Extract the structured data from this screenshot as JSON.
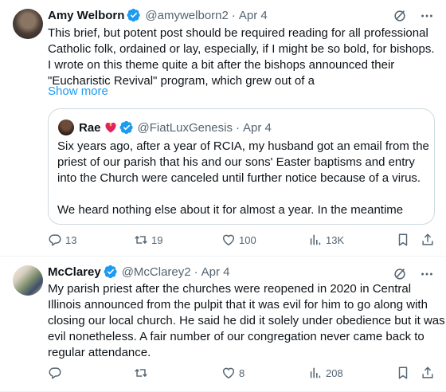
{
  "tweets": [
    {
      "name": "Amy Welborn",
      "handle": "@amywelborn2",
      "separator": "·",
      "date": "Apr 4",
      "text_lines": [
        "This brief, but potent post should be required reading for all professional",
        "Catholic folk, ordained or lay, especially, if I might be so bold, for bishops.",
        "I wrote on this theme quite a bit after the bishops announced their",
        "\"Eucharistic Revival\" program, which grew out of a"
      ],
      "show_more": "Show more",
      "quote": {
        "name": "Rae",
        "handle": "@FiatLuxGenesis",
        "separator": "·",
        "date": "Apr 4",
        "text_lines": [
          "Six years ago, after a year of RCIA, my husband got an email from the",
          "priest of our parish that his and our sons' Easter baptisms and entry",
          "into the Church were canceled until further notice because of a virus.",
          "",
          "We heard nothing else about it for almost a year. In the meantime"
        ]
      },
      "actions": {
        "replies": "13",
        "reposts": "19",
        "likes": "100",
        "views": "13K"
      }
    },
    {
      "name": "McClarey",
      "handle": "@McClarey2",
      "separator": "·",
      "date": "Apr 4",
      "text_lines": [
        "My parish priest after the churches were reopened in 2020 in Central",
        "Illinois announced from the pulpit that it was evil for him to go along with",
        "closing our local church.  He said he did it solely under obedience but it was",
        "evil nonetheless.  A fair number of our congregation never came back to",
        "regular attendance."
      ],
      "actions": {
        "replies": "",
        "reposts": "",
        "likes": "8",
        "views": "208"
      }
    }
  ],
  "colors": {
    "text": "#0f1419",
    "secondary": "#536471",
    "link": "#1d9bf0",
    "verified": "#1d9bf0",
    "border": "#cfd9de"
  },
  "icons": [
    "verified-badge-icon",
    "grok-icon",
    "more-icon",
    "reply-icon",
    "repost-icon",
    "like-icon",
    "views-icon",
    "bookmark-icon",
    "share-icon",
    "heart-emoji-icon"
  ]
}
